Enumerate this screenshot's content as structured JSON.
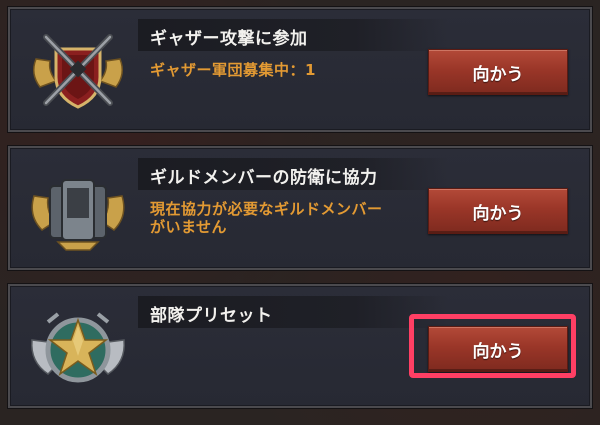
{
  "cards": [
    {
      "title": "ギャザー攻撃に参加",
      "subtitle_lines": [
        "ギャザー軍団募集中：1"
      ],
      "button_label": "向かう",
      "emblem_icon": "crossed-rifles-shield-icon"
    },
    {
      "title": "ギルドメンバーの防衛に協力",
      "subtitle_lines": [
        "現在協力が必要なギルドメンバー",
        "がいません"
      ],
      "button_label": "向かう",
      "emblem_icon": "shields-wings-icon"
    },
    {
      "title": "部隊プリセット",
      "subtitle_lines": [],
      "button_label": "向かう",
      "emblem_icon": "star-wings-emblem-icon"
    }
  ],
  "colors": {
    "subtitle": "#e39a33",
    "button": "#9a3628",
    "highlight": "#ff3f64"
  }
}
